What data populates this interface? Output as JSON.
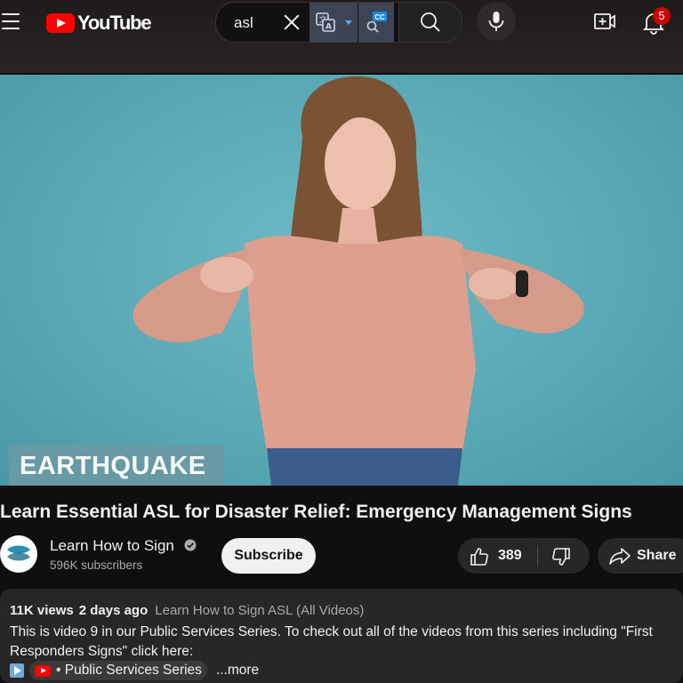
{
  "header": {
    "logo_text": "YouTube",
    "search": {
      "value": "asl",
      "placeholder": "Search"
    },
    "translate_ext_icon": "translate-icon",
    "cc_ext_label": "CC",
    "notifications_count": "5"
  },
  "video": {
    "overlay_caption": "EARTHQUAKE",
    "title": "Learn Essential ASL for Disaster Relief: Emergency Management Signs"
  },
  "channel": {
    "name": "Learn How to Sign",
    "subscribers": "596K subscribers",
    "subscribe_label": "Subscribe"
  },
  "actions": {
    "like_count": "389",
    "share_label": "Share"
  },
  "description": {
    "views": "11K views",
    "date": "2 days ago",
    "playlist": "Learn How to Sign ASL (All Videos)",
    "text": "This is video 9 in our Public Services Series. To check out all of the videos from this series including \"First Responders Signs\" click here:",
    "chip_label": "• Public Services Series",
    "more_label": "...more"
  },
  "colors": {
    "brand_red": "#ff0000",
    "background": "#0f0f0f",
    "video_bg": "#5aa9b6",
    "ext_bg": "#3d4554"
  }
}
